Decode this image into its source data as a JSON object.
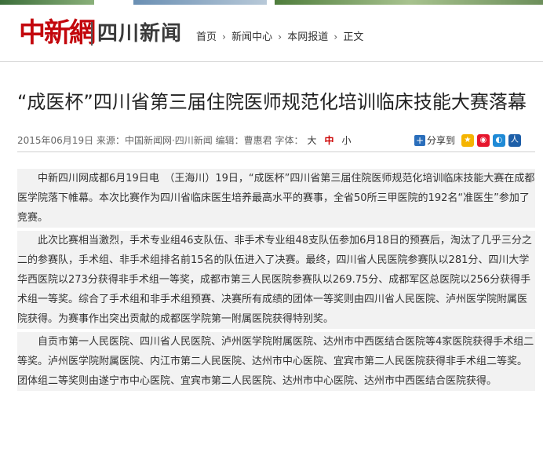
{
  "site": {
    "logo_main": "中新網",
    "logo_sub": "四川新闻"
  },
  "breadcrumb": [
    {
      "label": "首页"
    },
    {
      "label": "新闻中心"
    },
    {
      "label": "本网报道"
    },
    {
      "label": "正文"
    }
  ],
  "breadcrumb_sep": "›",
  "article": {
    "title": "“成医杯”四川省第三届住院医师规范化培训临床技能大赛落幕",
    "date": "2015年06月19日",
    "source_label": "来源：",
    "source": "中国新闻网·四川新闻",
    "editor_label": "编辑：",
    "editor": "曹惠君",
    "font_label": "字体：",
    "font_large": "大",
    "font_mid": "中",
    "font_small": "小",
    "share_label": "分享到",
    "paragraphs": [
      "中新四川网成都6月19日电　（王海川）19日，“成医杯”四川省第三届住院医师规范化培训临床技能大赛在成都医学院落下帷幕。本次比赛作为四川省临床医生培养最高水平的赛事，全省50所三甲医院的192名“准医生”参加了竞赛。",
      "此次比赛相当激烈，手术专业组46支队伍、非手术专业组48支队伍参加6月18日的预赛后，淘汰了几乎三分之二的参赛队，手术组、非手术组排名前15名的队伍进入了决赛。最终，四川省人民医院参赛队以281分、四川大学华西医院以273分获得非手术组一等奖，成都市第三人民医院参赛队以269.75分、成都军区总医院以256分获得手术组一等奖。综合了手术组和非手术组预赛、决赛所有成绩的团体一等奖则由四川省人民医院、泸州医学院附属医院获得。为赛事作出突出贡献的成都医学院第一附属医院获得特别奖。",
      "自贡市第一人民医院、四川省人民医院、泸州医学院附属医院、达州市中西医结合医院等4家医院获得手术组二等奖。泸州医学院附属医院、内江市第二人民医院、达州市中心医院、宜宾市第二人民医院获得非手术组二等奖。团体组二等奖则由遂宁市中心医院、宜宾市第二人民医院、达州市中心医院、达州市中西医结合医院获得。"
    ]
  },
  "colors": {
    "brand_red": "#c3070d",
    "share_blue": "#2a6ebb"
  },
  "share_icons": [
    "qzone-icon",
    "weibo-icon",
    "tencent-weibo-icon",
    "renren-icon"
  ]
}
